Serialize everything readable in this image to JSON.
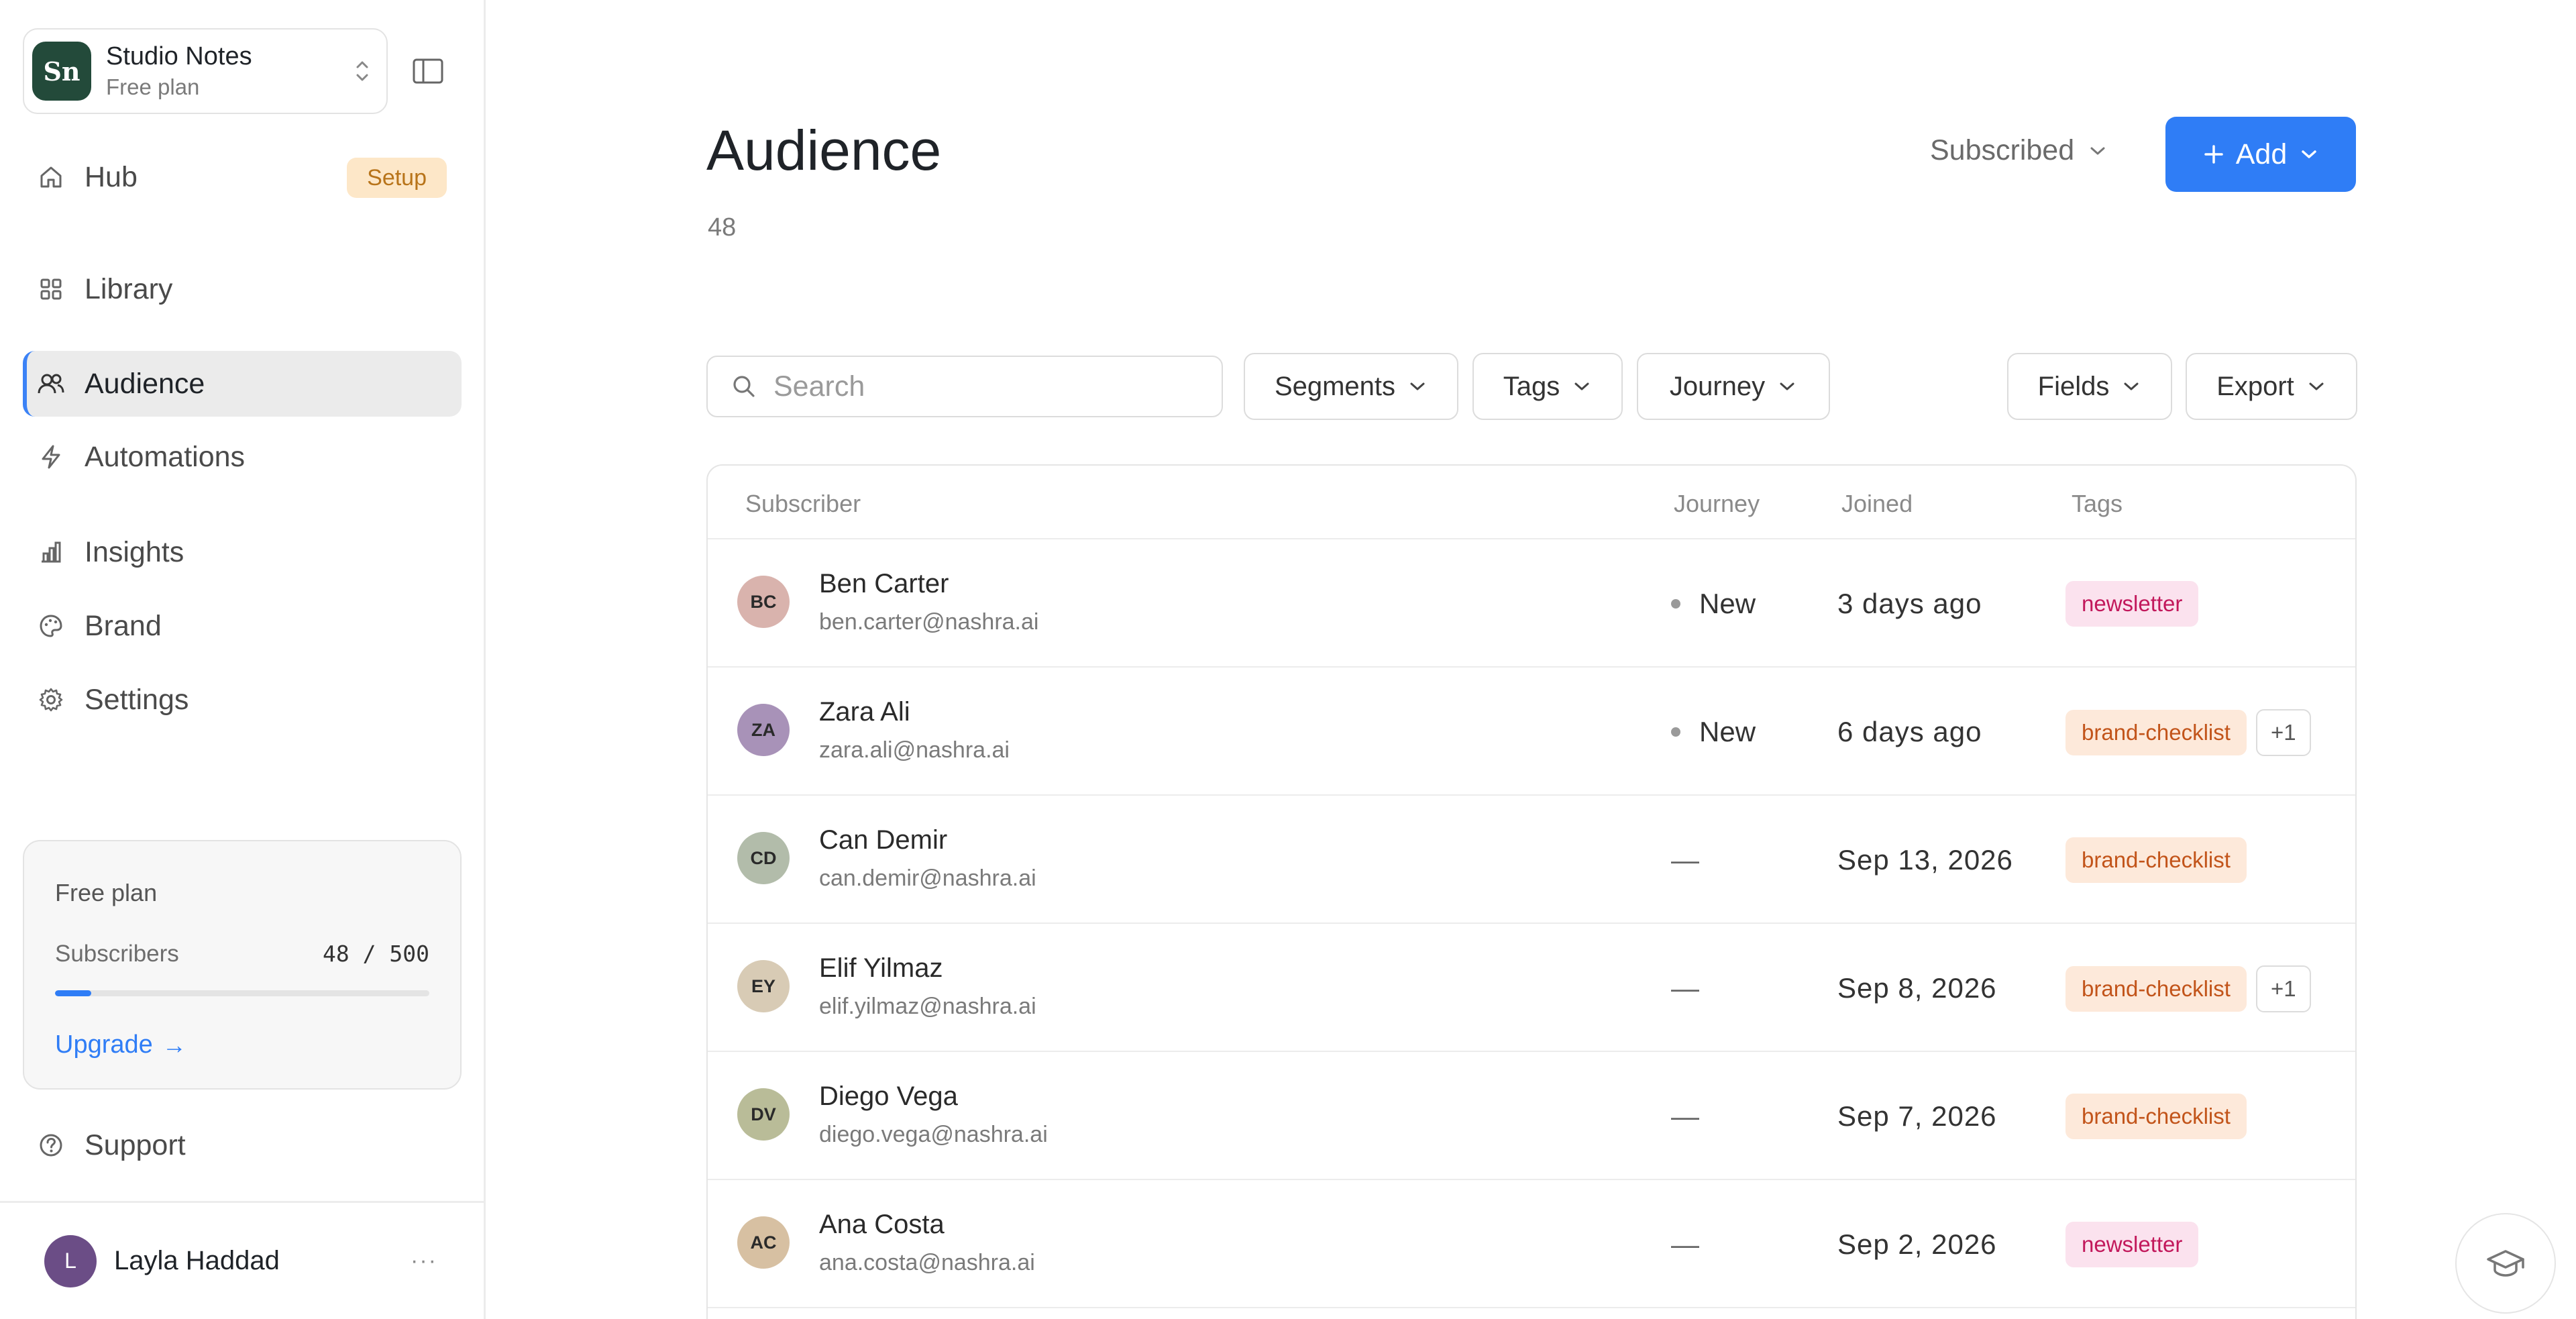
{
  "workspace": {
    "logo": "Sn",
    "name": "Studio Notes",
    "plan": "Free plan"
  },
  "nav": [
    {
      "label": "Hub",
      "icon": "home-icon",
      "badge": "Setup"
    },
    {
      "label": "Library",
      "icon": "grid-icon"
    },
    {
      "label": "Audience",
      "icon": "users-icon",
      "active": true
    },
    {
      "label": "Automations",
      "icon": "bolt-icon"
    },
    {
      "label": "Insights",
      "icon": "bar-chart-icon"
    },
    {
      "label": "Brand",
      "icon": "palette-icon"
    },
    {
      "label": "Settings",
      "icon": "gear-icon"
    }
  ],
  "plan_card": {
    "title": "Free plan",
    "subscribers_label": "Subscribers",
    "subscribers_value": "48 / 500",
    "usage_fraction": 0.096,
    "upgrade_label": "Upgrade",
    "upgrade_arrow": "→"
  },
  "support": {
    "label": "Support",
    "icon": "help-circle-icon"
  },
  "user": {
    "initial": "L",
    "name": "Layla Haddad",
    "more": "···"
  },
  "page": {
    "title": "Audience",
    "count": "48",
    "status_filter": "Subscribed",
    "add_label": "Add"
  },
  "toolbar": {
    "search_placeholder": "Search",
    "segments": "Segments",
    "tags": "Tags",
    "journey": "Journey",
    "fields": "Fields",
    "export": "Export"
  },
  "table": {
    "headers": {
      "subscriber": "Subscriber",
      "journey": "Journey",
      "joined": "Joined",
      "tags": "Tags"
    },
    "rows": [
      {
        "initials": "BC",
        "name": "Ben Carter",
        "email": "ben.carter@nashra.ai",
        "journey": "New",
        "joined": "3 days ago",
        "tags": [
          "newsletter"
        ],
        "more": "",
        "avatar_color": "#d9b3ad"
      },
      {
        "initials": "ZA",
        "name": "Zara Ali",
        "email": "zara.ali@nashra.ai",
        "journey": "New",
        "joined": "6 days ago",
        "tags": [
          "brand-checklist"
        ],
        "more": "+1",
        "avatar_color": "#a892b8"
      },
      {
        "initials": "CD",
        "name": "Can Demir",
        "email": "can.demir@nashra.ai",
        "journey": "—",
        "joined": "Sep 13, 2026",
        "tags": [
          "brand-checklist"
        ],
        "more": "",
        "avatar_color": "#b2bcaa"
      },
      {
        "initials": "EY",
        "name": "Elif Yilmaz",
        "email": "elif.yilmaz@nashra.ai",
        "journey": "—",
        "joined": "Sep 8, 2026",
        "tags": [
          "brand-checklist"
        ],
        "more": "+1",
        "avatar_color": "#d8cbb5"
      },
      {
        "initials": "DV",
        "name": "Diego Vega",
        "email": "diego.vega@nashra.ai",
        "journey": "—",
        "joined": "Sep 7, 2026",
        "tags": [
          "brand-checklist"
        ],
        "more": "",
        "avatar_color": "#b9bc98"
      },
      {
        "initials": "AC",
        "name": "Ana Costa",
        "email": "ana.costa@nashra.ai",
        "journey": "—",
        "joined": "Sep 2, 2026",
        "tags": [
          "newsletter"
        ],
        "more": "",
        "avatar_color": "#d7c0a2"
      }
    ]
  },
  "help": {
    "icon": "graduation-cap-icon"
  }
}
